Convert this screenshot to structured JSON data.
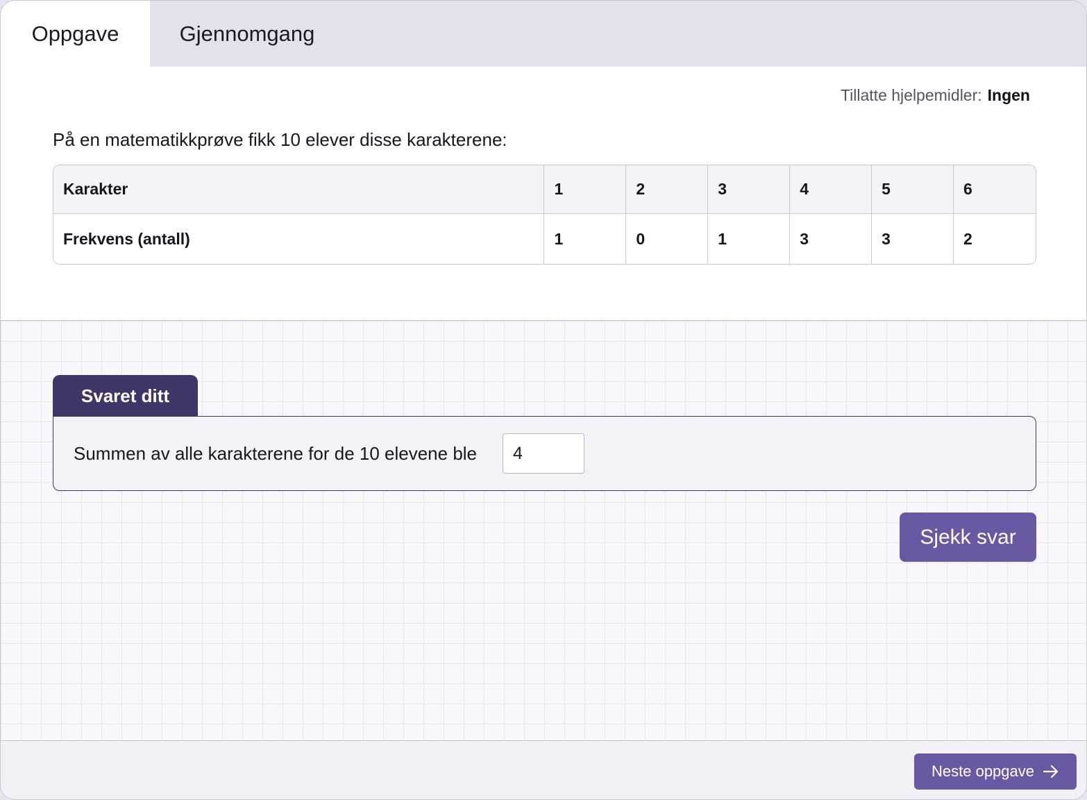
{
  "tabs": [
    {
      "label": "Oppgave",
      "active": true
    },
    {
      "label": "Gjennomgang",
      "active": false
    }
  ],
  "aids": {
    "label": "Tillatte hjelpemidler:",
    "value": "Ingen"
  },
  "question": "På en matematikkprøve fikk 10 elever disse karakterene:",
  "table": {
    "rows": [
      {
        "label": "Karakter",
        "values": [
          "1",
          "2",
          "3",
          "4",
          "5",
          "6"
        ]
      },
      {
        "label": "Frekvens (antall)",
        "values": [
          "1",
          "0",
          "1",
          "3",
          "3",
          "2"
        ]
      }
    ]
  },
  "answer": {
    "tab_label": "Svaret ditt",
    "prompt": "Summen av alle karakterene for de 10 elevene ble",
    "input_value": "4"
  },
  "check_button": "Sjekk svar",
  "next_button": "Neste oppgave",
  "colors": {
    "accent": "#6a58a2",
    "accent_dark": "#3f3566"
  },
  "icons": {
    "next": "arrow-right-icon"
  }
}
